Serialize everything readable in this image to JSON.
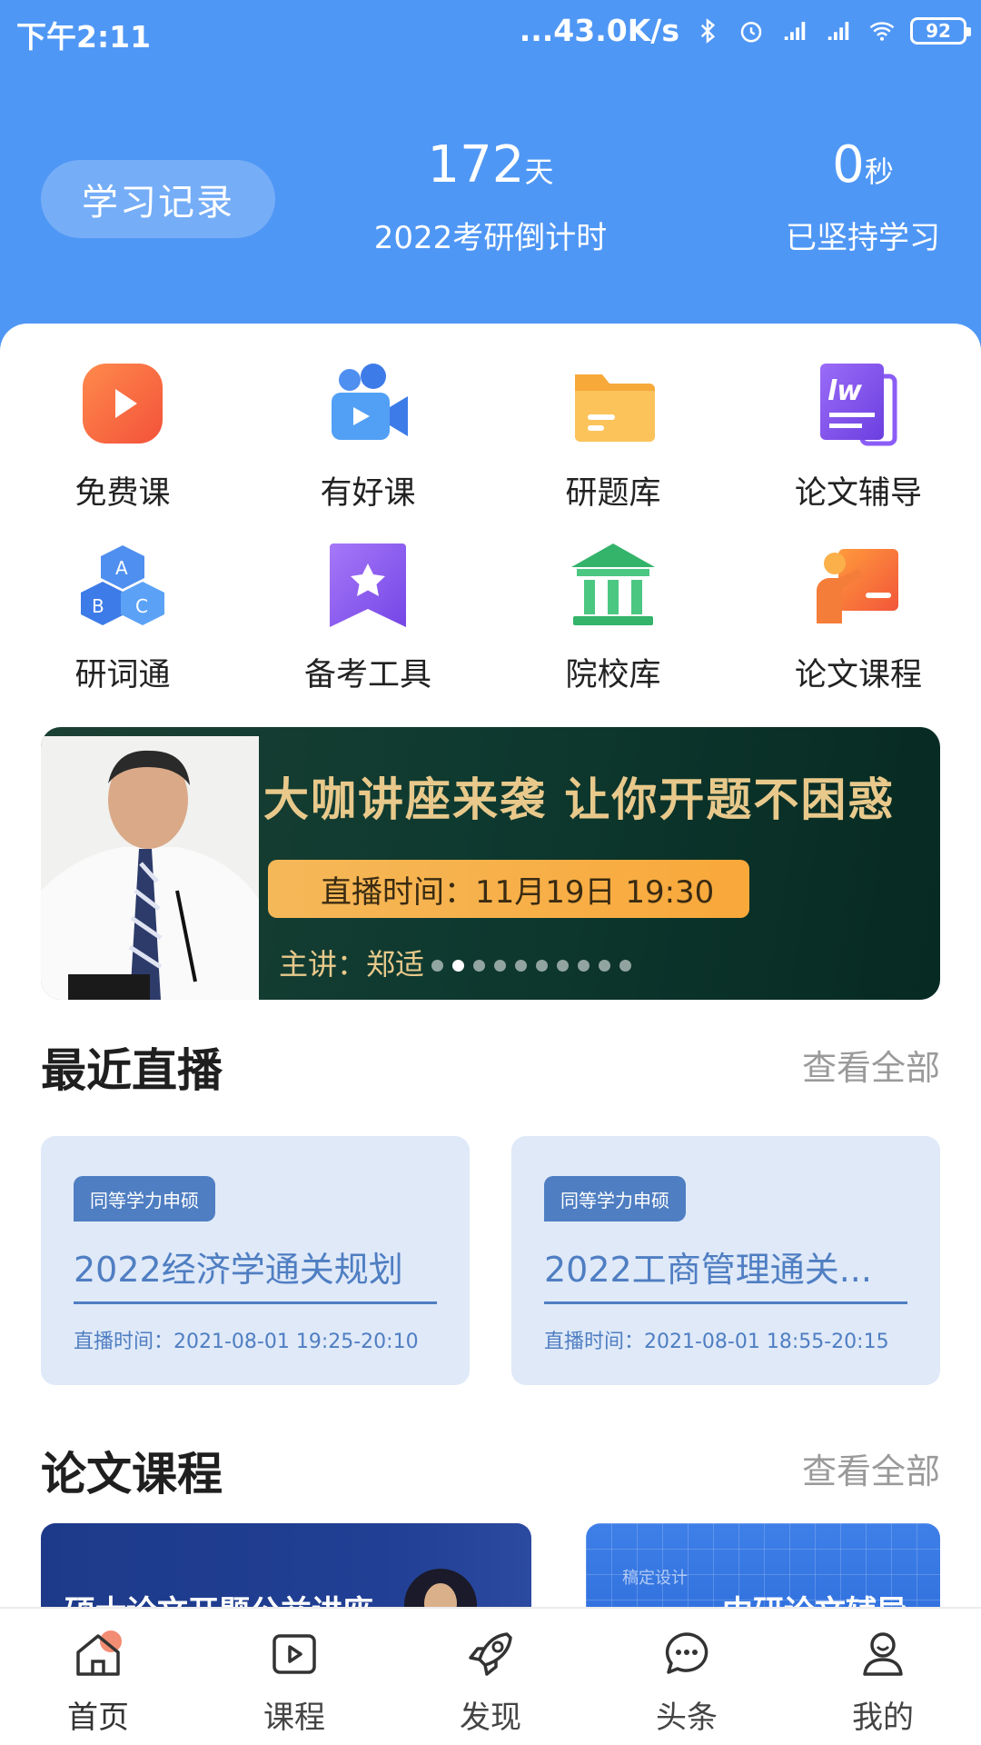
{
  "status_bar": {
    "time": "下午2:11",
    "network_speed": "...43.0K/s",
    "battery": "92"
  },
  "header": {
    "study_record_button": "学习记录",
    "countdown": {
      "value": "172",
      "unit": "天",
      "label": "2022考研倒计时"
    },
    "study_time": {
      "value": "0",
      "unit": "秒",
      "label": "已坚持学习"
    }
  },
  "grid": [
    {
      "label": "免费课",
      "icon": "play-icon"
    },
    {
      "label": "有好课",
      "icon": "video-camera-icon"
    },
    {
      "label": "研题库",
      "icon": "folder-icon"
    },
    {
      "label": "论文辅导",
      "icon": "lw-document-icon"
    },
    {
      "label": "研词通",
      "icon": "abc-cubes-icon"
    },
    {
      "label": "备考工具",
      "icon": "star-bookmark-icon"
    },
    {
      "label": "院校库",
      "icon": "institution-icon"
    },
    {
      "label": "论文课程",
      "icon": "teacher-board-icon"
    }
  ],
  "banner": {
    "title": "大咖讲座来袭 让你开题不困惑",
    "live_time": "直播时间：11月19日 19:30",
    "speaker": "主讲：郑适",
    "slide_count": 10,
    "active_slide": 1
  },
  "recent_live": {
    "title": "最近直播",
    "see_all": "查看全部",
    "cards": [
      {
        "tag": "同等学力申硕",
        "title": "2022经济学通关规划",
        "time": "直播时间：2021-08-01 19:25-20:10"
      },
      {
        "tag": "同等学力申硕",
        "title": "2022工商管理通关...",
        "time": "直播时间：2021-08-01 18:55-20:15"
      }
    ]
  },
  "thesis_courses": {
    "title": "论文课程",
    "see_all": "查看全部",
    "cards": [
      {
        "title": "硕士论文开题公益讲座"
      },
      {
        "subtitle": "稿定设计",
        "title": "中研论文辅导"
      }
    ]
  },
  "bottom_nav": [
    {
      "label": "首页",
      "icon": "home-icon",
      "active": true
    },
    {
      "label": "课程",
      "icon": "course-play-icon",
      "active": false
    },
    {
      "label": "发现",
      "icon": "rocket-icon",
      "active": false
    },
    {
      "label": "头条",
      "icon": "chat-bubble-icon",
      "active": false
    },
    {
      "label": "我的",
      "icon": "user-icon",
      "active": false
    }
  ],
  "colors": {
    "header_blue": "#4f97f5",
    "live_card_bg": "#dfe9f8",
    "live_accent": "#4f7ec2",
    "banner_gold": "#e8c98b"
  }
}
